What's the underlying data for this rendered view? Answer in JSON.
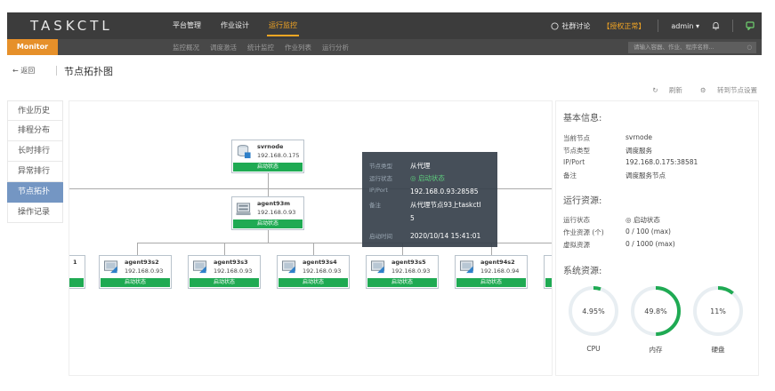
{
  "header": {
    "logo": "TASKCTL",
    "nav": [
      "平台管理",
      "作业设计",
      "运行监控"
    ],
    "active_nav": "运行监控",
    "community": "社群讨论",
    "license": "【授权正常】",
    "user": "admin ▾"
  },
  "subbar": {
    "module": "Monitor",
    "tabs": [
      "监控概况",
      "调度激活",
      "统计监控",
      "作业列表",
      "运行分析"
    ],
    "search_placeholder": "请输入容器、作业、程序名称..."
  },
  "page": {
    "back": "← 返回",
    "title": "节点拓扑图",
    "refresh": "刷新",
    "goto_settings": "转到节点设置"
  },
  "left_menu": {
    "items": [
      "作业历史",
      "排程分布",
      "长时排行",
      "异常排行",
      "节点拓扑",
      "操作记录"
    ],
    "active_index": 4
  },
  "topology": {
    "root": {
      "name": "svrnode",
      "ip": "192.168.0.175",
      "status": "启动状态"
    },
    "middle": {
      "name": "agent93m",
      "ip": "192.168.0.93",
      "status": "启动状态"
    },
    "partial_left": {
      "name": "1"
    },
    "children": [
      {
        "name": "agent93s2",
        "ip": "192.168.0.93",
        "status": "启动状态"
      },
      {
        "name": "agent93s3",
        "ip": "192.168.0.93",
        "status": "启动状态"
      },
      {
        "name": "agent93s4",
        "ip": "192.168.0.93",
        "status": "启动状态"
      },
      {
        "name": "agent93s5",
        "ip": "192.168.0.93",
        "status": "启动状态"
      },
      {
        "name": "agent94s2",
        "ip": "192.168.0.94",
        "status": "启动状态"
      }
    ]
  },
  "tooltip": {
    "type_key": "节点类型",
    "type_val": "从代理",
    "state_key": "运行状态",
    "state_val": "启动状态",
    "ip_key": "IP/Port",
    "ip_val": "192.168.0.93:28585",
    "note_key": "备注",
    "note_val_1": "从代理节点93上taskctl",
    "note_val_2": "5",
    "start_key": "启动时间",
    "start_val": "2020/10/14 15:41:01"
  },
  "info": {
    "basic_title": "基本信息:",
    "node_k": "当前节点",
    "node_v": "svrnode",
    "type_k": "节点类型",
    "type_v": "调度服务",
    "ip_k": "IP/Port",
    "ip_v": "192.168.0.175:38581",
    "note_k": "备注",
    "note_v": "调度服务节点",
    "run_title": "运行资源:",
    "state_k": "运行状态",
    "state_v": "启动状态",
    "job_k": "作业资源 (个)",
    "job_v": "0 / 100  (max)",
    "virt_k": "虚拟资源",
    "virt_v": "0 / 1000  (max)",
    "sys_title": "系统资源:",
    "gauges": [
      {
        "label": "CPU",
        "value_text": "4.95%",
        "percent": 4.95
      },
      {
        "label": "内存",
        "value_text": "49.8%",
        "percent": 49.8
      },
      {
        "label": "硬盘",
        "value_text": "11%",
        "percent": 11
      }
    ]
  },
  "colors": {
    "accent": "#f5a623",
    "status_green": "#1faa53",
    "menu_active": "#7496c3",
    "gauge_track": "#e8eef2"
  }
}
